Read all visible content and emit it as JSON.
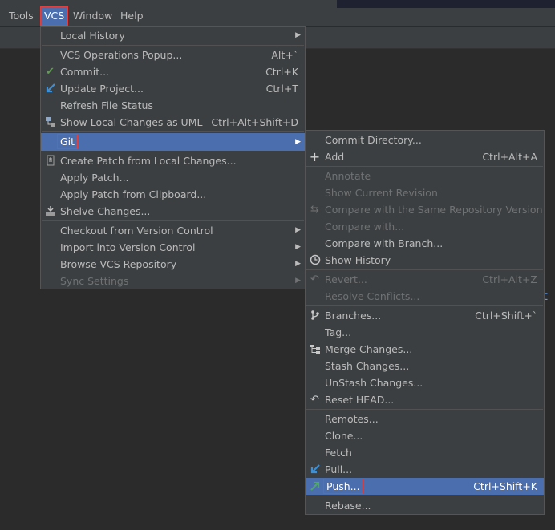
{
  "menubar": {
    "items": [
      {
        "label": "Tools"
      },
      {
        "label": "VCS"
      },
      {
        "label": "Window"
      },
      {
        "label": "Help"
      }
    ]
  },
  "vcs_menu": {
    "items": [
      {
        "label": "Local History"
      },
      {
        "label": "VCS Operations Popup...",
        "shortcut": "Alt+`"
      },
      {
        "label": "Commit...",
        "shortcut": "Ctrl+K",
        "icon": "check-icon"
      },
      {
        "label": "Update Project...",
        "shortcut": "Ctrl+T",
        "icon": "update-arrow-icon"
      },
      {
        "label": "Refresh File Status"
      },
      {
        "label": "Show Local Changes as UML",
        "shortcut": "Ctrl+Alt+Shift+D",
        "icon": "uml-icon"
      },
      {
        "label": "Git"
      },
      {
        "label": "Create Patch from Local Changes...",
        "icon": "patch-icon"
      },
      {
        "label": "Apply Patch..."
      },
      {
        "label": "Apply Patch from Clipboard..."
      },
      {
        "label": "Shelve Changes...",
        "icon": "shelve-icon"
      },
      {
        "label": "Checkout from Version Control"
      },
      {
        "label": "Import into Version Control"
      },
      {
        "label": "Browse VCS Repository"
      },
      {
        "label": "Sync Settings"
      }
    ]
  },
  "git_menu": {
    "items": [
      {
        "label": "Commit Directory..."
      },
      {
        "label": "Add",
        "shortcut": "Ctrl+Alt+A",
        "icon": "plus-icon"
      },
      {
        "label": "Annotate"
      },
      {
        "label": "Show Current Revision"
      },
      {
        "label": "Compare with the Same Repository Version",
        "icon": "compare-icon"
      },
      {
        "label": "Compare with..."
      },
      {
        "label": "Compare with Branch..."
      },
      {
        "label": "Show History",
        "icon": "clock-icon"
      },
      {
        "label": "Revert...",
        "shortcut": "Ctrl+Alt+Z",
        "icon": "revert-icon"
      },
      {
        "label": "Resolve Conflicts..."
      },
      {
        "label": "Branches...",
        "shortcut": "Ctrl+Shift+`",
        "icon": "branch-icon"
      },
      {
        "label": "Tag..."
      },
      {
        "label": "Merge Changes...",
        "icon": "merge-icon"
      },
      {
        "label": "Stash Changes..."
      },
      {
        "label": "UnStash Changes..."
      },
      {
        "label": "Reset HEAD...",
        "icon": "reset-icon"
      },
      {
        "label": "Remotes..."
      },
      {
        "label": "Clone..."
      },
      {
        "label": "Fetch"
      },
      {
        "label": "Pull...",
        "icon": "pull-icon"
      },
      {
        "label": "Push...",
        "shortcut": "Ctrl+Shift+K",
        "icon": "push-icon"
      },
      {
        "label": "Rebase..."
      }
    ]
  },
  "background": {
    "fragment": "t"
  },
  "colors": {
    "accent": "#4b6eaf",
    "highlight_border": "#e04040",
    "check": "#5e9e4e",
    "update_arrow": "#3d8fd6",
    "push_arrow": "#4fa56b"
  }
}
